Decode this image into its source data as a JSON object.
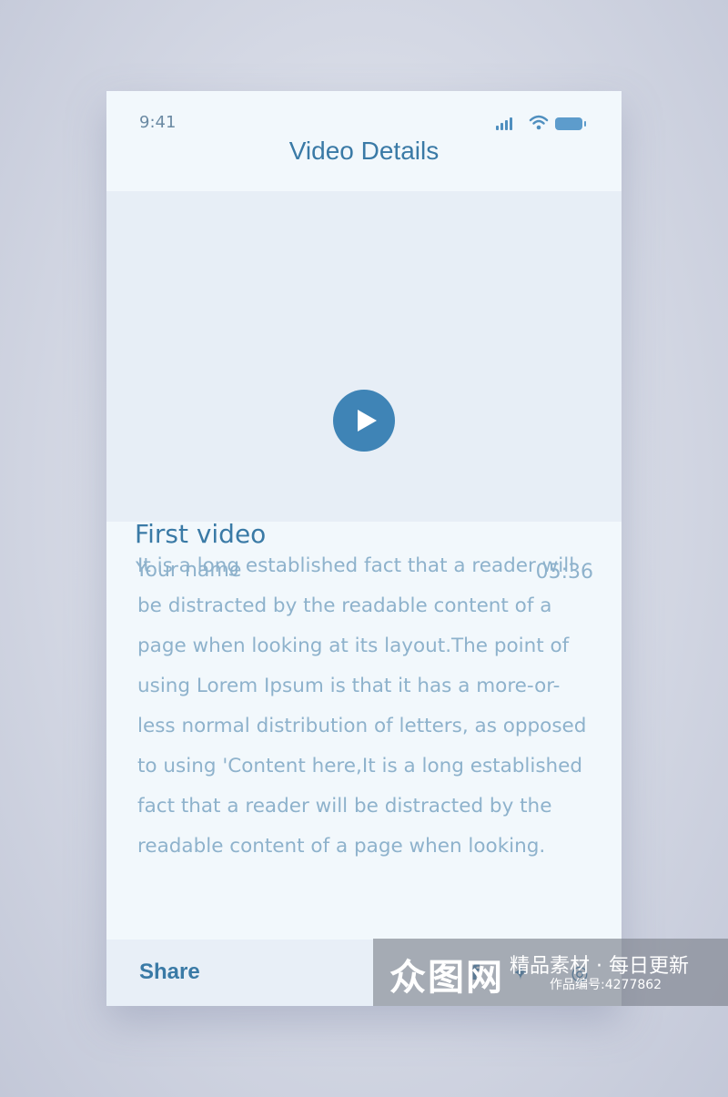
{
  "status_bar": {
    "time": "9:41",
    "icons": [
      "signal-icon",
      "wifi-icon",
      "battery-icon"
    ]
  },
  "header": {
    "title": "Video Details"
  },
  "video": {
    "play_icon": "play-icon",
    "title": "First video",
    "author": "Your name",
    "duration": "05:36"
  },
  "description": "It is a long established fact that a reader will be distracted by the readable content of a page when looking at its layout.The point of using Lorem Ipsum is that it has a more-or-less normal distribution of letters, as opposed to using 'Content here,It is a long established fact that a reader will be distracted by the readable content of a page when looking.",
  "footer": {
    "share_label": "Share",
    "social": [
      {
        "name": "facebook-icon",
        "glyph": "f"
      },
      {
        "name": "twitter-icon",
        "glyph": "✦"
      },
      {
        "name": "instagram-icon",
        "glyph": "◎"
      }
    ]
  },
  "watermark": {
    "logo": "众图网",
    "tagline": "精品素材 · 每日更新",
    "id": "作品编号:4277862"
  }
}
